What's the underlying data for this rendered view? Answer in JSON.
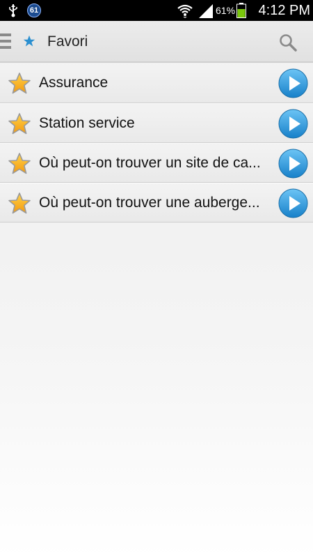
{
  "status_bar": {
    "notification_badge": "61",
    "battery_percent": "61%",
    "time": "4:12 PM",
    "icons": [
      "usb-icon",
      "notification-icon",
      "wifi-icon",
      "signal-icon",
      "battery-icon"
    ]
  },
  "action_bar": {
    "title": "Favori",
    "icons": [
      "menu-icon",
      "star-icon",
      "search-icon"
    ]
  },
  "favorites": [
    {
      "label": "Assurance"
    },
    {
      "label": "Station service"
    },
    {
      "label": "Où peut-on trouver un site de ca..."
    },
    {
      "label": "Où peut-on trouver une auberge..."
    }
  ],
  "colors": {
    "star_fill": "#f6a81a",
    "play_button": "#2c95d8",
    "accent_star": "#2a8fd0"
  }
}
